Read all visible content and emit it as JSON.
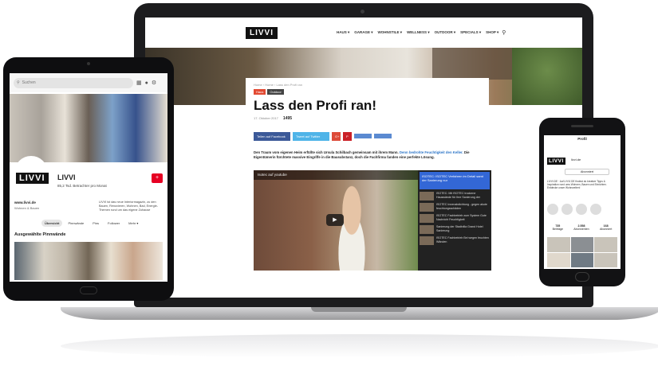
{
  "colors": {
    "brand_dark": "#111111",
    "pinterest_red": "#e60023",
    "link_blue": "#2b74c7",
    "playlist_blue": "#3367d6"
  },
  "laptop": {
    "site": {
      "logo": "LIVVI",
      "nav": [
        "HAUS ▾",
        "GARAGE ▾",
        "WOHNSTILE ▾",
        "WELLNESS ▾",
        "OUTDOOR ▾",
        "SPECIALS ▾",
        "SHOP ▾"
      ],
      "breadcrumb": "Home › Home › Lass den Profi ran",
      "tags": [
        "Haus",
        "Outdoor"
      ],
      "headline": "Lass den Profi ran!",
      "date": "17. Oktober 2017",
      "views": "1495",
      "share": {
        "facebook": "Teilen auf Facebook",
        "twitter": "Tweet auf Twitter",
        "google": "G+",
        "pinterest": "P",
        "extra1": "",
        "extra2": ""
      },
      "intro_text": "Den Traum vom eigenen Heim erfüllte sich Ursula Schilbach gemeinsam mit ihrem Mann.",
      "intro_link": "Denn bedrohte Feuchtigkeit den Keller.",
      "intro_rest": "Die Eigentümerin fürchtete massive Eingriffe in die Bausubstanz, doch die Fachfirma fanden eine perfekte Lösung.",
      "video": {
        "title": "Isotec auf youtube",
        "play": "▶",
        "now_playing": "ISOTEC: ISOTEC Verfahren im Detail samt der Sanierung nur",
        "playlist": [
          "ISOTEC: Mit ISOTEC trockene Hauswände für Ihre Sanierung der",
          "ISOTEC Innenabdichtung - gegen akute feuchtungsschäden",
          "ISOTEC Fachbetrieb zum System Gute Nachricht Feuchtigkeit",
          "Sanierung der Stadtvilla Grand Hotel Sanierung",
          "ISOTEC Fachbetrieb Bei wegen feuchten Wänden"
        ]
      }
    }
  },
  "tablet": {
    "search_placeholder": "Suchen",
    "profile_name": "LIVVI",
    "logo": "LIVVI",
    "views": "85,2 Tsd. Betrachter pro Monat",
    "url": "www.livvi.de",
    "subtitle": "Wohnen & Bauen",
    "description": "LIVVI ist das neue Interiormagazin, zu den Bauen, Renovieren, Wohnen, Bad, Energie- Themen rund um das eigene Zuhause",
    "tabs": [
      "Übersicht",
      "Pinnwände",
      "Pins",
      "Follower",
      "Mehr ▾"
    ],
    "active_tab": "Übersicht",
    "section_title": "Ausgewählte Pinnwände",
    "plus": "+"
  },
  "phone": {
    "title": "Profil",
    "logo": "LIVVI",
    "handle": "livvi.de",
    "follow": "Abonniert",
    "bio": "LIVVI.DE · Auf LIVVI.DE findest du kreative Tipps & Inspiration rund ums Wohnen, Bauen und Einrichten. Entdecke unser Wohnwelten!",
    "stats": [
      {
        "value": "735",
        "label": "Beiträge"
      },
      {
        "value": "2.558",
        "label": "Abonnenten"
      },
      {
        "value": "168",
        "label": "Abonniert"
      }
    ]
  }
}
